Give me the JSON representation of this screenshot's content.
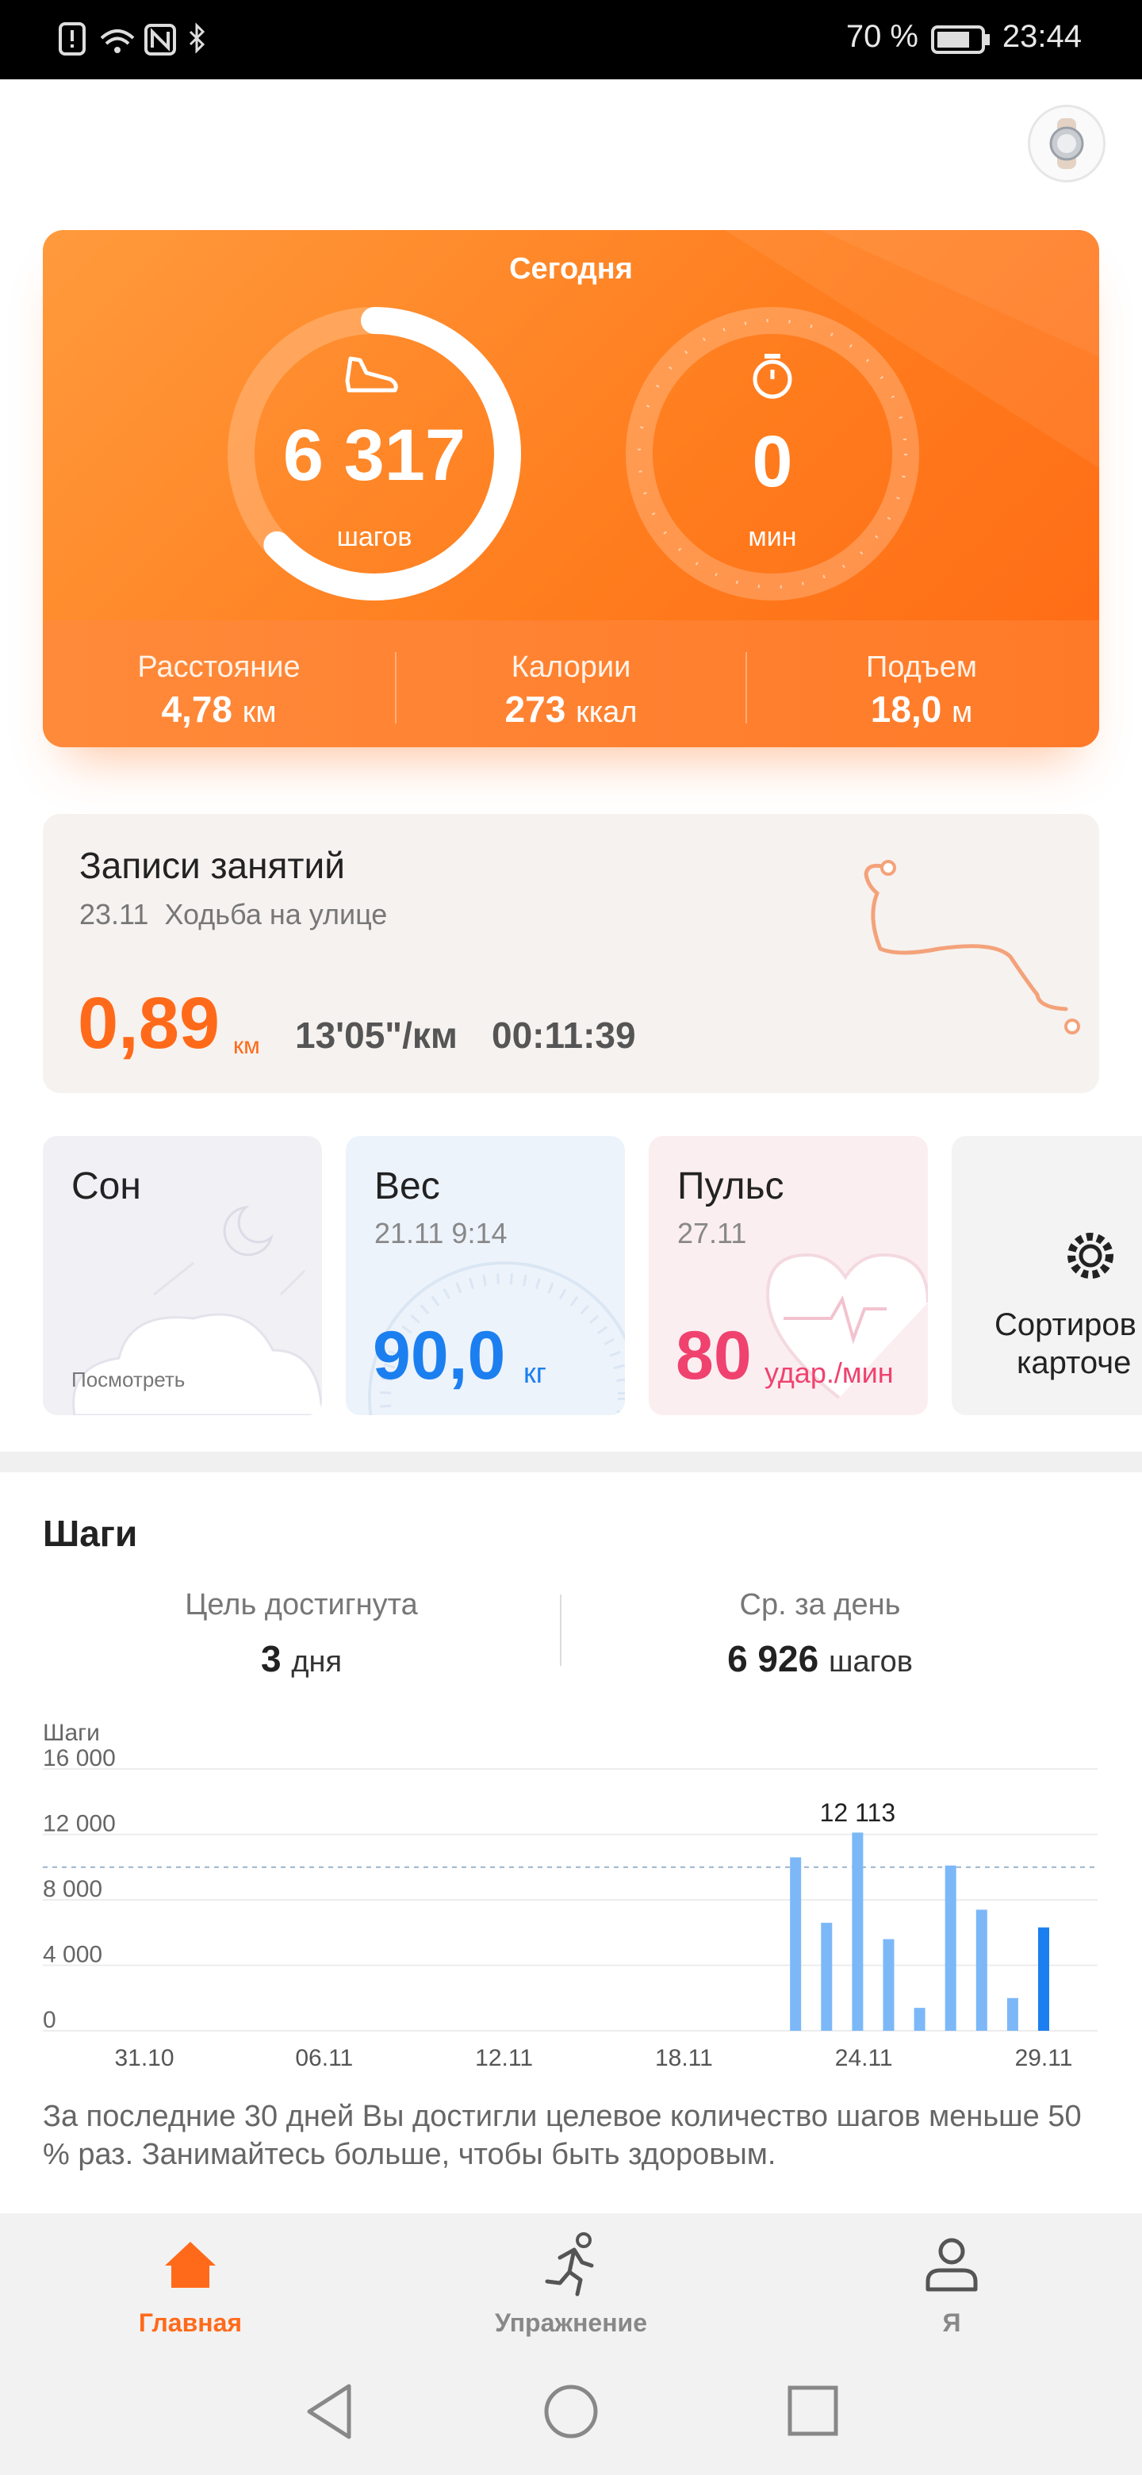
{
  "status_bar": {
    "battery": "70 %",
    "time": "23:44"
  },
  "today": {
    "label": "Сегодня",
    "steps_value": "6 317",
    "steps_unit": "шагов",
    "steps_progress": 0.63,
    "active_value": "0",
    "active_unit": "мин",
    "metrics": [
      {
        "title": "Расстояние",
        "value": "4,78",
        "unit": "км"
      },
      {
        "title": "Калории",
        "value": "273",
        "unit": "ккал"
      },
      {
        "title": "Подъем",
        "value": "18,0",
        "unit": "м"
      }
    ]
  },
  "records": {
    "title": "Записи занятий",
    "date": "23.11",
    "activity": "Ходьба на улице",
    "distance": "0,89",
    "distance_unit": "км",
    "pace": "13'05\"/км",
    "duration": "00:11:39"
  },
  "cards": {
    "sleep": {
      "title": "Сон",
      "link": "Посмотреть"
    },
    "weight": {
      "title": "Вес",
      "date": "21.11 9:14",
      "value": "90,0",
      "unit": "кг"
    },
    "pulse": {
      "title": "Пульс",
      "date": "27.11",
      "value": "80",
      "unit": "удар./мин"
    },
    "sort": {
      "line1": "Сортиров",
      "line2": "карточе"
    }
  },
  "steps": {
    "title": "Шаги",
    "goal_label": "Цель достигнута",
    "goal_value": "3",
    "goal_unit": "дня",
    "avg_label": "Ср. за день",
    "avg_value": "6 926",
    "avg_unit": "шагов",
    "summary": "За последние 30 дней Вы достигли целевое количество шагов меньше 50 % раз. Занимайтесь больше, чтобы быть здоровым."
  },
  "chart_data": {
    "type": "bar",
    "ylabel": "Шаги",
    "y_ticks": [
      "16 000",
      "12 000",
      "8 000",
      "4 000",
      "0"
    ],
    "ylim": [
      0,
      16000
    ],
    "x_tick_labels": [
      "31.10",
      "06.11",
      "12.11",
      "18.11",
      "24.11",
      "29.11"
    ],
    "goal_line": 10000,
    "highlight_label": "12 113",
    "categories": [
      "21.11",
      "22.11",
      "23.11",
      "24.11",
      "25.11",
      "26.11",
      "27.11",
      "28.11",
      "29.11"
    ],
    "values": [
      10600,
      6600,
      12113,
      5600,
      1400,
      10100,
      7400,
      2000,
      6317
    ],
    "bar_color": "#7cb8f7",
    "current_bar_color": "#1c7ff0"
  },
  "nav": {
    "home": "Главная",
    "exercise": "Упражнение",
    "me": "Я"
  },
  "colors": {
    "accent": "#ff6a1a",
    "blue": "#1c7ff0",
    "pink": "#f0426e"
  }
}
